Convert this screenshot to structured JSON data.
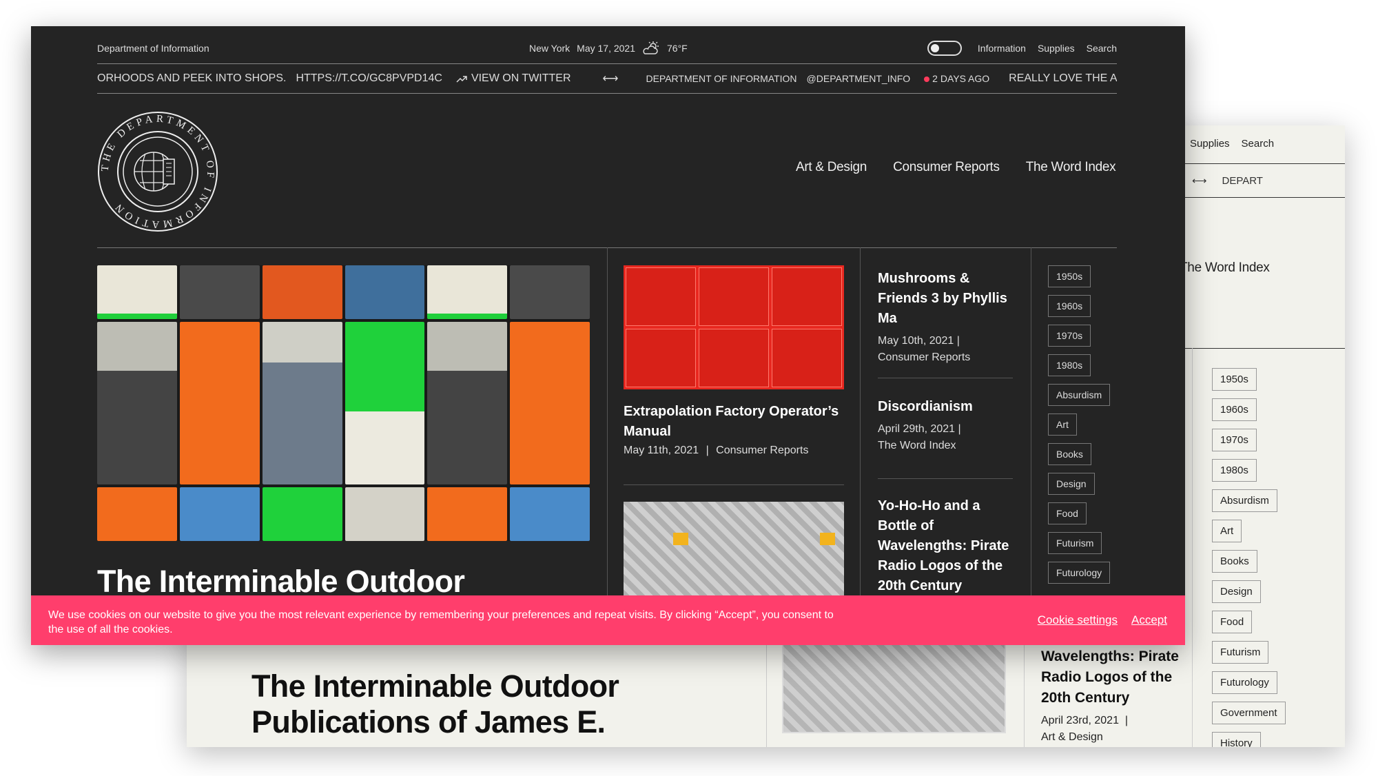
{
  "back": {
    "nav": [
      "Supplies",
      "Search"
    ],
    "ticker": {
      "arrow": "⟷",
      "text": "DEPART"
    },
    "word_index": "The Word Index",
    "tags": [
      "1950s",
      "1960s",
      "1970s",
      "1980s",
      "Absurdism",
      "Art",
      "Books",
      "Design",
      "Food",
      "Futurism",
      "Futurology",
      "Government",
      "History"
    ],
    "hero_title_line1": "The Interminable Outdoor",
    "hero_title_line2": "Publications of James E.",
    "pirate_title": "Wavelengths: Pirate Radio Logos of the 20th Century",
    "pirate_date": "April 23rd, 2021",
    "pirate_cat": "Art & Design"
  },
  "front": {
    "topbar": {
      "dept": "Department of Information",
      "city": "New York",
      "date": "May 17, 2021",
      "temp": "76°F",
      "links": [
        "Information",
        "Supplies",
        "Search"
      ]
    },
    "ticker": {
      "tweet_tail": "ORHOODS AND PEEK INTO SHOPS.",
      "url": "HTTPS://T.CO/GC8PVPD14C",
      "view": "VIEW ON TWITTER",
      "arrow": "⟷",
      "account": "DEPARTMENT OF INFORMATION",
      "handle": "@DEPARTMENT_INFO",
      "ago": "2 DAYS AGO",
      "next": "REALLY LOVE THE ANIMA"
    },
    "logo_text": "THE DEPARTMENT OF INFORMATION",
    "nav": [
      "Art & Design",
      "Consumer Reports",
      "The Word Index"
    ],
    "hero_title": "The Interminable Outdoor",
    "article1": {
      "title": "Extrapolation Factory Operator’s Manual",
      "date": "May 11th, 2021",
      "sep": "|",
      "cat": "Consumer Reports"
    },
    "column3": [
      {
        "title": "Mushrooms & Friends 3 by Phyllis Ma",
        "date": "May 10th, 2021",
        "sep": "|",
        "cat": "Consumer Reports"
      },
      {
        "title": "Discordianism",
        "date": "April 29th, 2021",
        "sep": "|",
        "cat": "The Word Index"
      },
      {
        "title": "Yo-Ho-Ho and a Bottle of Wavelengths: Pirate Radio Logos of the 20th Century",
        "date": "",
        "sep": "",
        "cat": ""
      }
    ],
    "tags": [
      "1950s",
      "1960s",
      "1970s",
      "1980s",
      "Absurdism",
      "Art",
      "Books",
      "Design",
      "Food",
      "Futurism",
      "Futurology"
    ],
    "cookie": {
      "text": "We use cookies on our website to give you the most relevant experience by remembering your preferences and repeat visits. By clicking “Accept”, you consent to the use of all the cookies.",
      "settings": "Cookie settings",
      "accept": "Accept"
    }
  }
}
